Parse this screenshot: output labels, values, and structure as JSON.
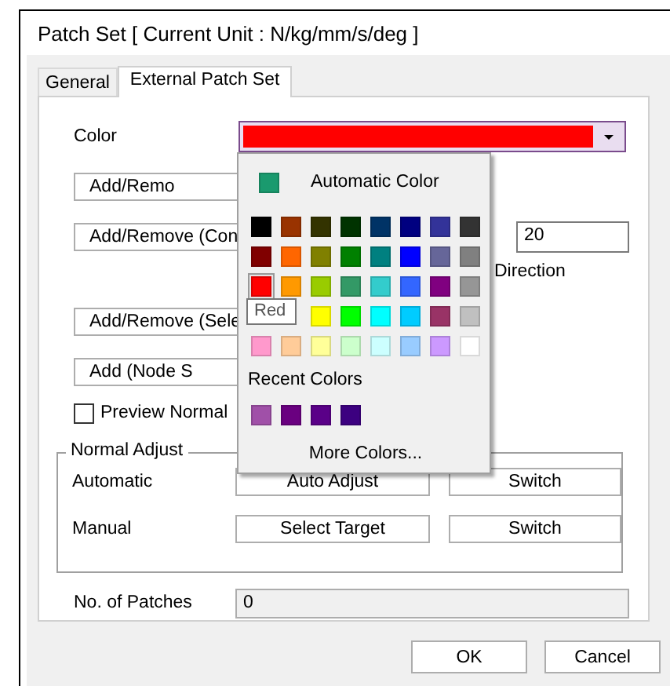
{
  "window": {
    "title": "Patch Set [ Current Unit : N/kg/mm/s/deg ]"
  },
  "tabs": [
    {
      "label": "General",
      "selected": false
    },
    {
      "label": "External Patch Set",
      "selected": true
    }
  ],
  "color_row": {
    "label": "Color",
    "color": "#ff0000",
    "expanded": true
  },
  "buttons": [
    {
      "label": "Add/Remo"
    },
    {
      "label": "Add/Remove (Con"
    }
  ],
  "count_field": {
    "value": "20"
  },
  "direction_label": "Direction",
  "buttons_2": [
    {
      "label": "Add/Remove (Sele"
    },
    {
      "label": "Add (Node S"
    }
  ],
  "preview": {
    "label": "Preview Normal",
    "checked": false
  },
  "normal_adjust": {
    "title": "Normal Adjust",
    "rows": [
      {
        "label": "Automatic",
        "buttons": [
          "Auto Adjust",
          "Switch"
        ]
      },
      {
        "label": "Manual",
        "buttons": [
          "Select Target",
          "Switch"
        ]
      }
    ]
  },
  "patches": {
    "label": "No. of Patches",
    "value": "0"
  },
  "dialog_buttons": [
    "OK",
    "Cancel"
  ],
  "color_popup": {
    "automatic": {
      "label": "Automatic Color",
      "color": "#1a9a6e"
    },
    "palette": [
      [
        {
          "color": "#000000",
          "selected": false
        },
        {
          "color": "#993300",
          "selected": false
        },
        {
          "color": "#333300",
          "selected": false
        },
        {
          "color": "#003300",
          "selected": false
        },
        {
          "color": "#003366",
          "selected": false
        },
        {
          "color": "#000080",
          "selected": false
        },
        {
          "color": "#333399",
          "selected": false
        },
        {
          "color": "#333333",
          "selected": false
        }
      ],
      [
        {
          "color": "#800000",
          "selected": false
        },
        {
          "color": "#ff6600",
          "selected": false
        },
        {
          "color": "#808000",
          "selected": false
        },
        {
          "color": "#008000",
          "selected": false
        },
        {
          "color": "#008080",
          "selected": false
        },
        {
          "color": "#0000ff",
          "selected": false
        },
        {
          "color": "#666699",
          "selected": false
        },
        {
          "color": "#808080",
          "selected": false
        }
      ],
      [
        {
          "color": "#ff0000",
          "selected": true
        },
        {
          "color": "#ff9900",
          "selected": false
        },
        {
          "color": "#99cc00",
          "selected": false
        },
        {
          "color": "#339966",
          "selected": false
        },
        {
          "color": "#33cccc",
          "selected": false
        },
        {
          "color": "#3366ff",
          "selected": false
        },
        {
          "color": "#800080",
          "selected": false
        },
        {
          "color": "#969696",
          "selected": false
        }
      ],
      [
        {
          "color": "#ffff00",
          "selected": false
        },
        {
          "color": "#00ff00",
          "selected": false
        },
        {
          "color": "#00ffff",
          "selected": false
        },
        {
          "color": "#00ccff",
          "selected": false
        },
        {
          "color": "#993366",
          "selected": false
        },
        {
          "color": "#c0c0c0",
          "selected": false
        }
      ],
      [
        {
          "color": "#ff99cc",
          "selected": false
        },
        {
          "color": "#ffcc99",
          "selected": false
        },
        {
          "color": "#ffff99",
          "selected": false
        },
        {
          "color": "#ccffcc",
          "selected": false
        },
        {
          "color": "#ccffff",
          "selected": false
        },
        {
          "color": "#99ccff",
          "selected": false
        },
        {
          "color": "#cc99ff",
          "selected": false
        },
        {
          "color": "#ffffff",
          "selected": false
        }
      ]
    ],
    "tooltip": "Red",
    "recent_title": "Recent Colors",
    "recent": [
      {
        "color": "#a050a8"
      },
      {
        "color": "#6a0080"
      },
      {
        "color": "#5a0088"
      },
      {
        "color": "#3c0080"
      }
    ],
    "more": "More Colors..."
  }
}
